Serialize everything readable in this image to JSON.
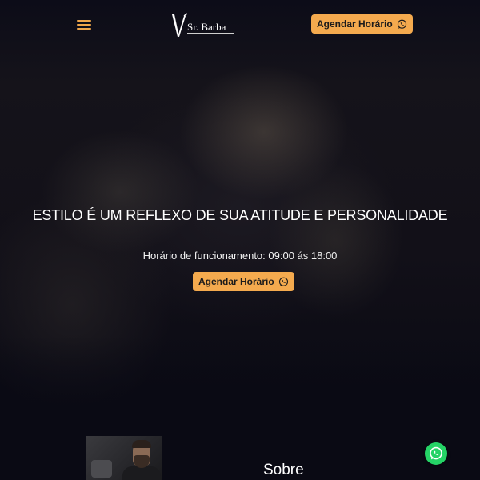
{
  "header": {
    "menu_icon": "hamburger-menu-icon",
    "logo_text": "Sr. Barba",
    "cta_label": "Agendar Horário",
    "cta_icon": "whatsapp-icon"
  },
  "hero": {
    "title": "ESTILO É UM REFLEXO DE SUA ATITUDE E PERSONALIDADE",
    "hours": "Horário de funcionamento: 09:00 ás 18:00",
    "cta_label": "Agendar Horário",
    "cta_icon": "whatsapp-icon"
  },
  "about": {
    "title": "Sobre"
  },
  "floating": {
    "icon": "whatsapp-icon"
  },
  "colors": {
    "accent": "#f4aa4e",
    "background": "#0a0a14",
    "whatsapp": "#25d366",
    "text": "#ffffff"
  }
}
